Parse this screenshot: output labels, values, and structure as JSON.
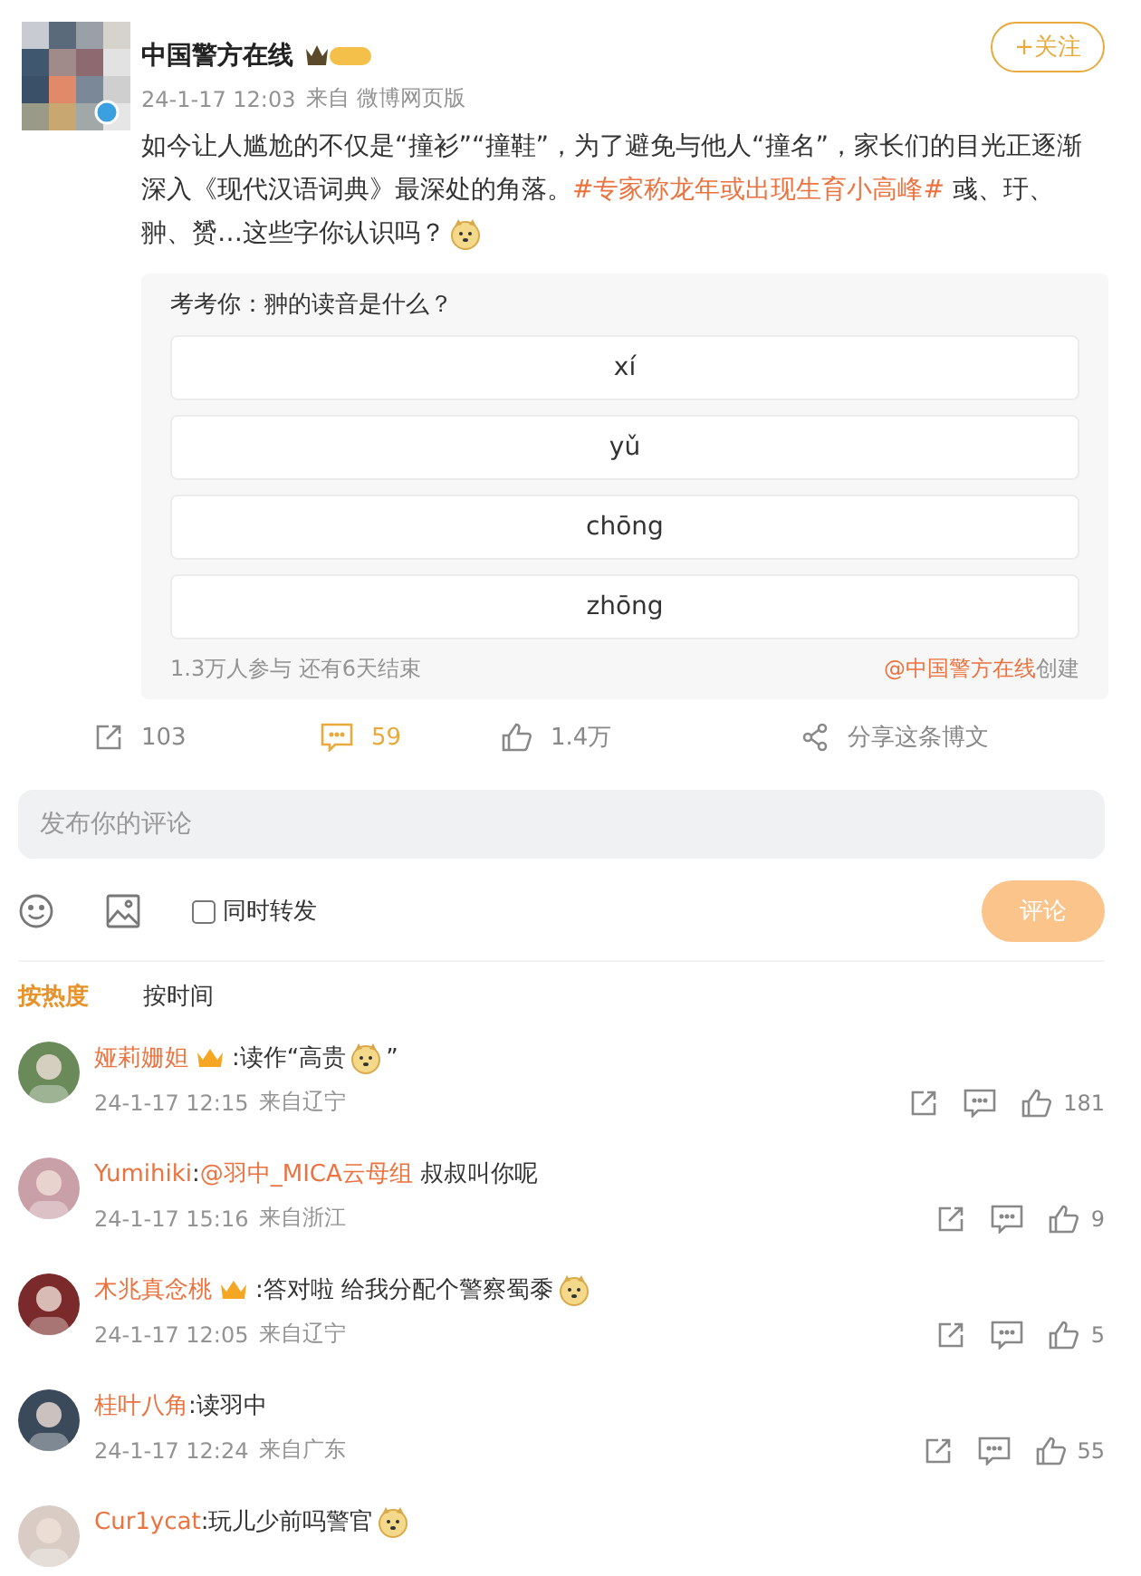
{
  "post": {
    "author": "中国警方在线",
    "follow": "+关注",
    "time": "24-1-17 12:03",
    "source": "来自 微博网页版",
    "body": [
      {
        "kind": "plain",
        "text": "如今让人尴尬的不仅是“撞衫”“撞鞋”，为了避免与他人“撞名”，家长们的目光正逐渐深入《现代汉语词典》最深处的角落。"
      },
      {
        "kind": "tag",
        "text": "#专家称龙年或出现生育小高峰#"
      },
      {
        "kind": "plain",
        "text": " 彧、玗、翀、赟…这些字你认识吗？"
      },
      {
        "kind": "emoji"
      }
    ]
  },
  "poll": {
    "question": "考考你：翀的读音是什么？",
    "options": [
      "xí",
      "yǔ",
      "chōng",
      "zhōng"
    ],
    "stats": "1.3万人参与 还有6天结束",
    "creator": "@中国警方在线",
    "created": "创建"
  },
  "actions": [
    {
      "kind": "forward",
      "text": "103",
      "active": false
    },
    {
      "kind": "comment",
      "text": "59",
      "active": true
    },
    {
      "kind": "like",
      "text": "1.4万",
      "active": false
    },
    {
      "kind": "share",
      "text": "分享这条博文",
      "active": false
    }
  ],
  "composer": {
    "placeholder": "发布你的评论",
    "repost_label": "同时转发",
    "repost_checked": false,
    "submit": "评论",
    "submit_disabled": true
  },
  "sort_tabs": [
    {
      "label": "按热度",
      "selected": true
    },
    {
      "label": "按时间",
      "selected": false
    }
  ],
  "comments": [
    {
      "name": "娅莉姗妲",
      "badge": true,
      "parts": [
        {
          "kind": "plain",
          "text": ":读作“高贵"
        },
        {
          "kind": "emoji"
        },
        {
          "kind": "plain",
          "text": "”"
        }
      ],
      "time": "24-1-17 12:15",
      "place": "来自辽宁",
      "likes": "181"
    },
    {
      "name": "Yumihiki",
      "badge": false,
      "parts": [
        {
          "kind": "plain",
          "text": ":"
        },
        {
          "kind": "mention",
          "text": "@羽中_MICA云母组"
        },
        {
          "kind": "plain",
          "text": " 叔叔叫你呢"
        }
      ],
      "time": "24-1-17 15:16",
      "place": "来自浙江",
      "likes": "9"
    },
    {
      "name": "木兆真念桃",
      "badge": true,
      "parts": [
        {
          "kind": "plain",
          "text": ":答对啦 给我分配个警察蜀黍"
        },
        {
          "kind": "emoji"
        }
      ],
      "time": "24-1-17 12:05",
      "place": "来自辽宁",
      "likes": "5"
    },
    {
      "name": "桂叶八角",
      "badge": false,
      "parts": [
        {
          "kind": "plain",
          "text": ":读羽中"
        }
      ],
      "time": "24-1-17 12:24",
      "place": "来自广东",
      "likes": "55"
    },
    {
      "name": "Cur1ycat",
      "badge": false,
      "parts": [
        {
          "kind": "plain",
          "text": ":玩儿少前吗警官"
        },
        {
          "kind": "emoji"
        }
      ]
    }
  ]
}
